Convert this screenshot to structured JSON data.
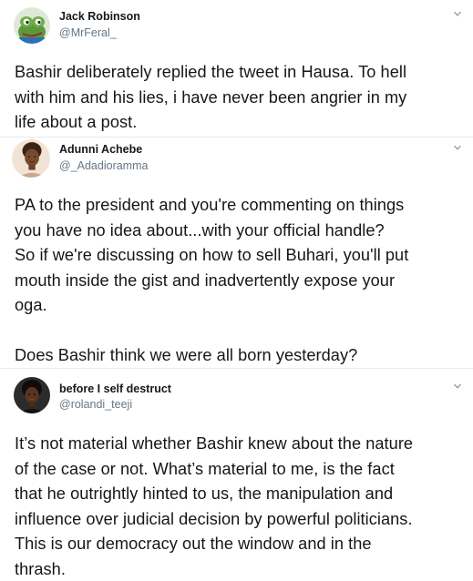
{
  "tweets": [
    {
      "name": "Jack Robinson",
      "handle": "@MrFeral_",
      "avatar_icon": "frog-avatar",
      "lines": [
        "Bashir deliberately replied the tweet in Hausa. To hell",
        "with him and his lies, i have never been angrier in my",
        "life about a post."
      ]
    },
    {
      "name": "Adunni Achebe",
      "handle": "@_Adadioramma",
      "avatar_icon": "woman-avatar",
      "lines": [
        "PA to the president and you're commenting on things",
        "you have no idea about...with your official handle?",
        "So if we're discussing on how to sell Buhari, you'll put",
        "mouth inside the gist and inadvertently expose your",
        "oga.",
        "",
        "Does Bashir think we were all born yesterday?"
      ]
    },
    {
      "name": "before I self destruct",
      "handle": "@rolandi_teeji",
      "avatar_icon": "woman-avatar-dark",
      "lines": [
        "It’s not material whether Bashir knew about the nature",
        "of the case or not. What’s material to me, is the fact",
        "that he outrightly hinted to us, the manipulation and",
        "influence over judicial decision by powerful politicians.",
        "This is our democracy out the window and in the",
        "thrash."
      ]
    }
  ],
  "colors": {
    "text": "#14171a",
    "secondary": "#657786",
    "divider": "#e6ecf0"
  }
}
